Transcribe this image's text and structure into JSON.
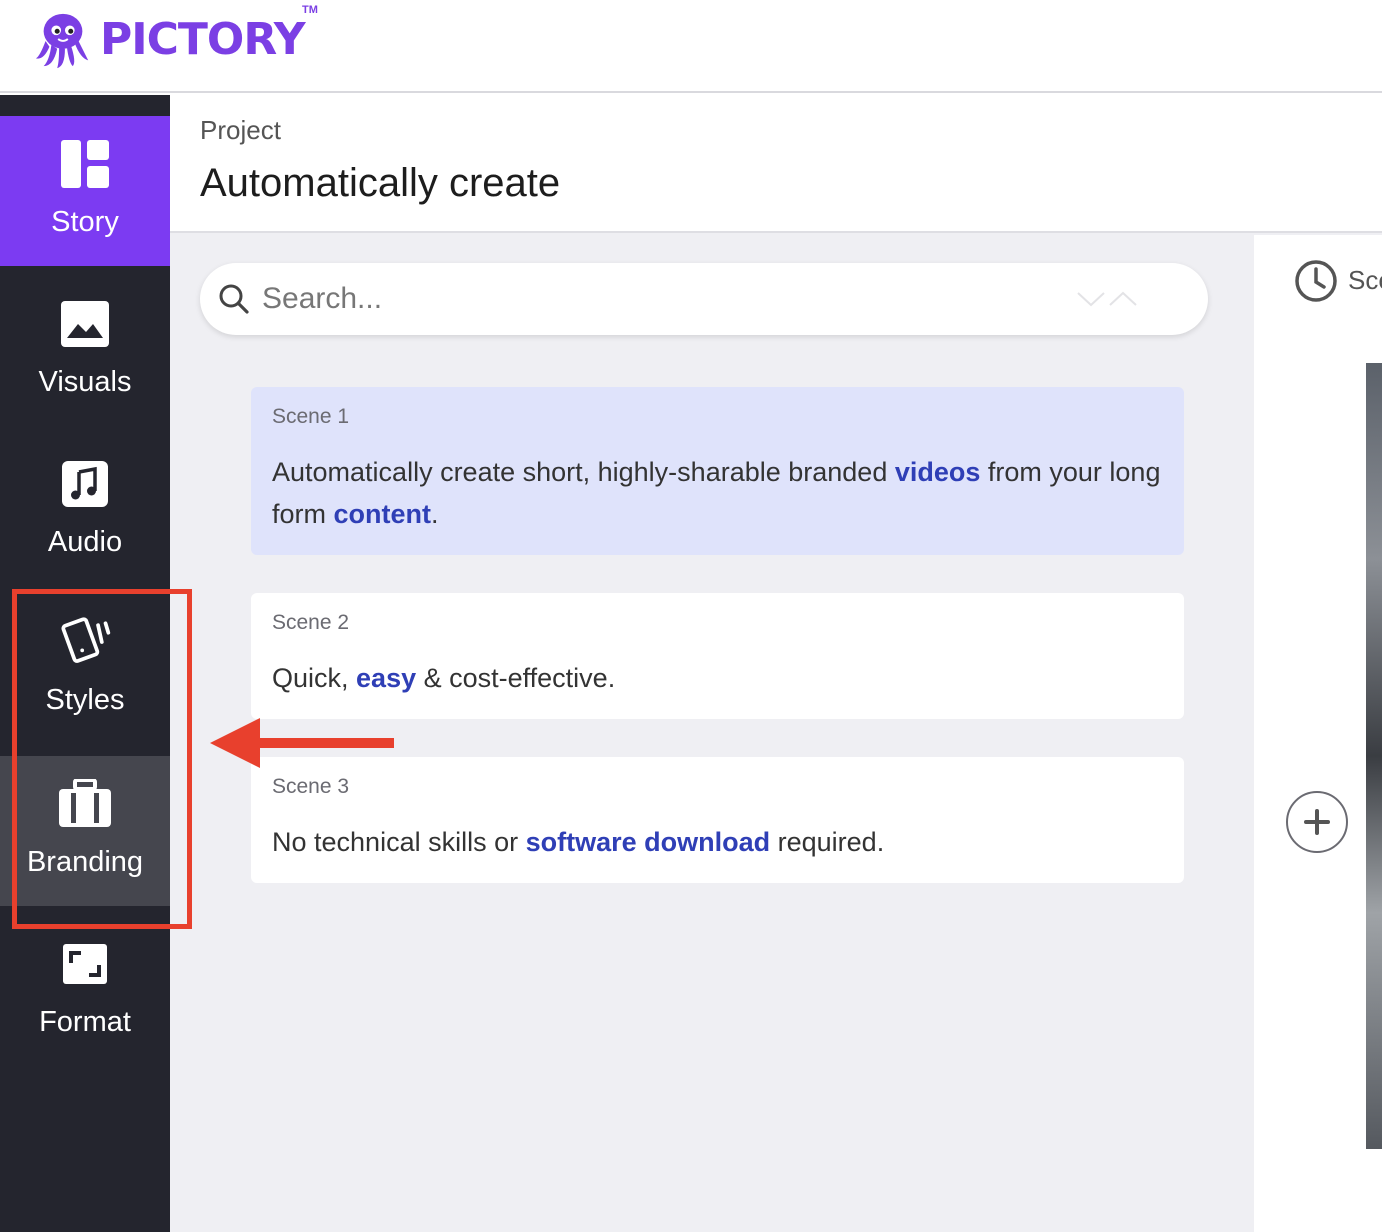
{
  "header": {
    "brand": "PICTORY",
    "trademark": "TM",
    "brand_color": "#7b3fe4"
  },
  "sidebar": {
    "items": [
      {
        "label": "Story",
        "icon": "layout-icon",
        "state": "active"
      },
      {
        "label": "Visuals",
        "icon": "image-icon",
        "state": "normal"
      },
      {
        "label": "Audio",
        "icon": "music-icon",
        "state": "normal"
      },
      {
        "label": "Styles",
        "icon": "cards-icon",
        "state": "normal"
      },
      {
        "label": "Branding",
        "icon": "briefcase-icon",
        "state": "hover"
      },
      {
        "label": "Format",
        "icon": "aspect-ratio-icon",
        "state": "normal"
      }
    ],
    "active_color": "#7c3bf2",
    "background_color": "#24252e"
  },
  "project": {
    "label": "Project",
    "title": "Automatically create"
  },
  "search": {
    "placeholder": "Search..."
  },
  "scenes": [
    {
      "label": "Scene 1",
      "selected": true,
      "parts": [
        {
          "text": "Automatically create short, highly-sharable branded ",
          "keyword": false
        },
        {
          "text": "videos",
          "keyword": true
        },
        {
          "text": " from your long form ",
          "keyword": false
        },
        {
          "text": "content",
          "keyword": true
        },
        {
          "text": ".",
          "keyword": false
        }
      ]
    },
    {
      "label": "Scene 2",
      "selected": false,
      "parts": [
        {
          "text": "Quick, ",
          "keyword": false
        },
        {
          "text": "easy",
          "keyword": true
        },
        {
          "text": " & cost-effective.",
          "keyword": false
        }
      ]
    },
    {
      "label": "Scene 3",
      "selected": false,
      "parts": [
        {
          "text": "No technical skills or ",
          "keyword": false
        },
        {
          "text": "software download",
          "keyword": true
        },
        {
          "text": " required.",
          "keyword": false
        }
      ]
    }
  ],
  "right_panel": {
    "truncated_label": "Sce"
  },
  "annotation": {
    "color": "#e8402d",
    "target": "Branding"
  }
}
